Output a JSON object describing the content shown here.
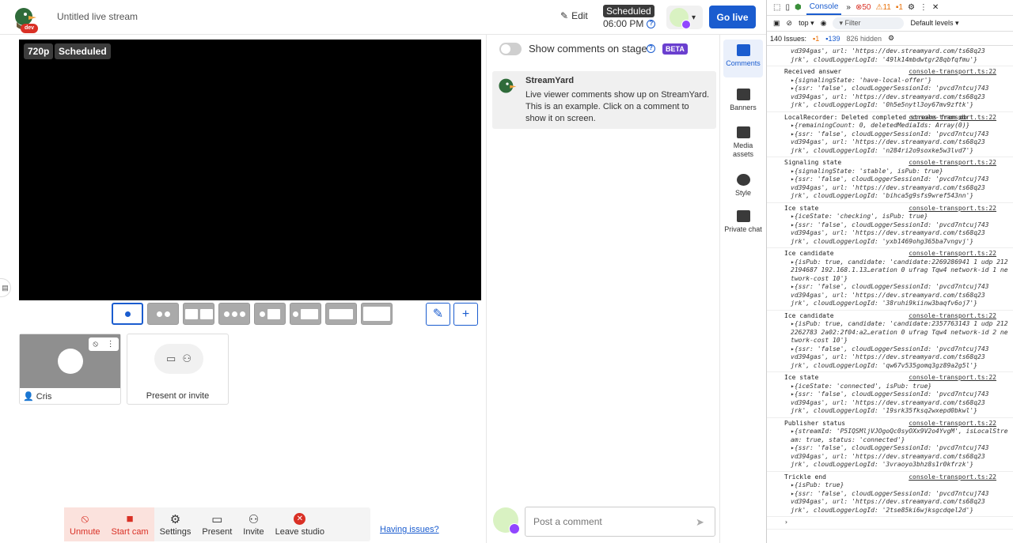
{
  "header": {
    "logo_badge": "dev",
    "stream_title": "Untitled live stream",
    "edit_label": "Edit",
    "scheduled_badge": "Scheduled",
    "scheduled_time": "06:00 PM",
    "go_live": "Go live"
  },
  "stage": {
    "resolution_badge": "720p",
    "status_badge": "Scheduled"
  },
  "layouts": [
    "solo",
    "two-split",
    "two-wide",
    "group",
    "leader",
    "news",
    "thin",
    "fullscreen"
  ],
  "tiles": {
    "participant_name": "Cris",
    "invite_label": "Present or invite"
  },
  "toolbar": {
    "unmute": "Unmute",
    "start_cam": "Start cam",
    "settings": "Settings",
    "present": "Present",
    "invite": "Invite",
    "leave": "Leave studio",
    "issues": "Having issues?"
  },
  "chat": {
    "show_comments": "Show comments on stage",
    "beta": "BETA",
    "message_author": "StreamYard",
    "message_text": "Live viewer comments show up on StreamYard. This is an example. Click on a comment to show it on screen.",
    "post_placeholder": "Post a comment"
  },
  "rail": {
    "comments": "Comments",
    "banners": "Banners",
    "media": "Media assets",
    "style": "Style",
    "private_chat": "Private chat"
  },
  "devtools": {
    "tab": "Console",
    "errors": "50",
    "warnings": "11",
    "info": "1",
    "context": "top",
    "filter": "Filter",
    "levels": "Default levels",
    "issues_label": "140 Issues:",
    "issues_a": "1",
    "issues_b": "139",
    "hidden": "826 hidden",
    "source": "console-transport.ts:22",
    "entries": [
      {
        "title": "",
        "lines": [
          "vd394gas', url: 'https://dev.streamyard.com/ts68q23",
          "jrk', cloudLoggerLogId: '49lk14mbdwtgr28qbfqfmu'}"
        ]
      },
      {
        "title": "Received answer",
        "lines": [
          "▸{signalingState: 'have-local-offer'}",
          "▸{ssr: 'false', cloudLoggerSessionId: 'pvcd7ntcuj743",
          "vd394gas', url: 'https://dev.streamyard.com/ts68q23",
          "jrk', cloudLoggerLogId: '0h5e5nytl3oy67mv9zftk'}"
        ]
      },
      {
        "title": "LocalRecorder: Deleted completed streams from db",
        "lines": [
          "▸{remainingCount: 0, deletedMediaIds: Array(0)}",
          "▸{ssr: 'false', cloudLoggerSessionId: 'pvcd7ntcuj743",
          "vd394gas', url: 'https://dev.streamyard.com/ts68q23",
          "jrk', cloudLoggerLogId: 'n284ri2o9soxke5w3lvd7'}"
        ]
      },
      {
        "title": "Signaling state",
        "lines": [
          "▸{signalingState: 'stable', isPub: true}",
          "▸{ssr: 'false', cloudLoggerSessionId: 'pvcd7ntcuj743",
          "vd394gas', url: 'https://dev.streamyard.com/ts68q23",
          "jrk', cloudLoggerLogId: 'bihca5g9sfs9wref543nn'}"
        ]
      },
      {
        "title": "Ice state",
        "lines": [
          "▸{iceState: 'checking', isPub: true}",
          "▸{ssr: 'false', cloudLoggerSessionId: 'pvcd7ntcuj743",
          "vd394gas', url: 'https://dev.streamyard.com/ts68q23",
          "jrk', cloudLoggerLogId: 'yxb1469ohg365ba7vngvj'}"
        ]
      },
      {
        "title": "Ice candidate",
        "lines": [
          "▸{isPub: true, candidate: 'candidate:2269286941 1 udp 2122194687 192.168.1.13…eration 0 ufrag Tqw4 network-id 1 network-cost 10'}",
          "▸{ssr: 'false', cloudLoggerSessionId: 'pvcd7ntcuj743",
          "vd394gas', url: 'https://dev.streamyard.com/ts68q23",
          "jrk', cloudLoggerLogId: '38ruhi9kiinw3baqfv6oj7'}"
        ]
      },
      {
        "title": "Ice candidate",
        "lines": [
          "▸{isPub: true, candidate: 'candidate:2357763143 1 udp 2122262783 2a02:2f04:a2…eration 0 ufrag Tqw4 network-id 2 network-cost 10'}",
          "▸{ssr: 'false', cloudLoggerSessionId: 'pvcd7ntcuj743",
          "vd394gas', url: 'https://dev.streamyard.com/ts68q23",
          "jrk', cloudLoggerLogId: 'qw67v535gomq3gz89a2g5l'}"
        ]
      },
      {
        "title": "Ice state",
        "lines": [
          "▸{iceState: 'connected', isPub: true}",
          "▸{ssr: 'false', cloudLoggerSessionId: 'pvcd7ntcuj743",
          "vd394gas', url: 'https://dev.streamyard.com/ts68q23",
          "jrk', cloudLoggerLogId: '19srk35fksq2wxepd0bkwl'}"
        ]
      },
      {
        "title": "Publisher status",
        "lines": [
          "▸{streamId: 'P5IQSMljVJOgoQc0syOXx9V2o4YvgM', isLocalStream: true, status: 'connected'}",
          "▸{ssr: 'false', cloudLoggerSessionId: 'pvcd7ntcuj743",
          "vd394gas', url: 'https://dev.streamyard.com/ts68q23",
          "jrk', cloudLoggerLogId: '3vraoyo3bhz8s1r0kfrzk'}"
        ]
      },
      {
        "title": "Trickle end",
        "lines": [
          "▸{isPub: true}",
          "▸{ssr: 'false', cloudLoggerSessionId: 'pvcd7ntcuj743",
          "vd394gas', url: 'https://dev.streamyard.com/ts68q23",
          "jrk', cloudLoggerLogId: '2tse85ki6wjksgcdqel2d'}"
        ]
      }
    ],
    "prompt": "›"
  }
}
